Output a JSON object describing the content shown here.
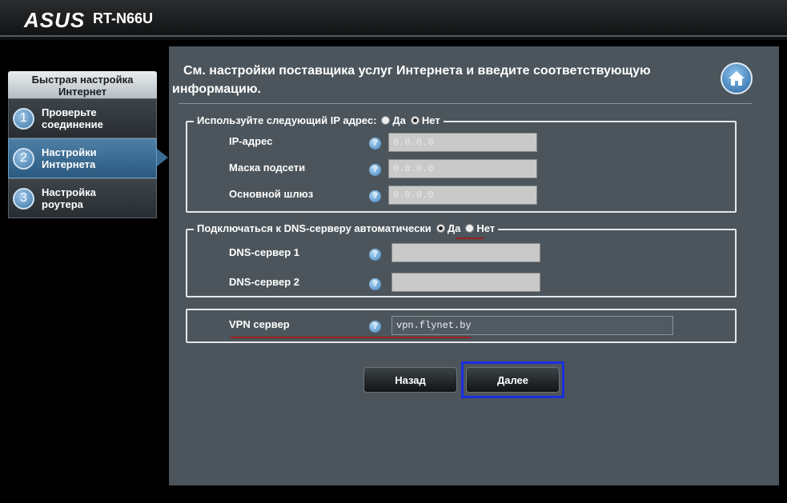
{
  "header": {
    "logo": "ASUS",
    "model": "RT-N66U"
  },
  "sidebar": {
    "title": "Быстрая настройка Интернет",
    "items": [
      {
        "num": "1",
        "label": "Проверьте соединение",
        "active": false
      },
      {
        "num": "2",
        "label": "Настройки Интернета",
        "active": true
      },
      {
        "num": "3",
        "label": "Настройка роутера",
        "active": false
      }
    ]
  },
  "main": {
    "title": "См. настройки поставщика услуг Интернета и введите соответствующую информацию.",
    "ip_group": {
      "legend": "Используйте следующий IP адрес:",
      "yes": "Да",
      "no": "Нет",
      "selected": "no",
      "fields": [
        {
          "label": "IP-адрес",
          "value": "0.0.0.0"
        },
        {
          "label": "Маска подсети",
          "value": "0.0.0.0"
        },
        {
          "label": "Основной шлюз",
          "value": "0.0.0.0"
        }
      ]
    },
    "dns_group": {
      "legend": "Подключаться к DNS-серверу автоматически",
      "yes": "Да",
      "no": "Нет",
      "selected": "yes",
      "fields": [
        {
          "label": "DNS-сервер 1",
          "value": ""
        },
        {
          "label": "DNS-сервер 2",
          "value": ""
        }
      ]
    },
    "vpn": {
      "label": "VPN сервер",
      "value": "vpn.flynet.by"
    },
    "help_glyph": "?",
    "buttons": {
      "back": "Назад",
      "next": "Далее"
    }
  },
  "colors": {
    "panel_bg": "#4c555b",
    "underline": "#9b1f1f",
    "focus": "#1a2fe0"
  }
}
